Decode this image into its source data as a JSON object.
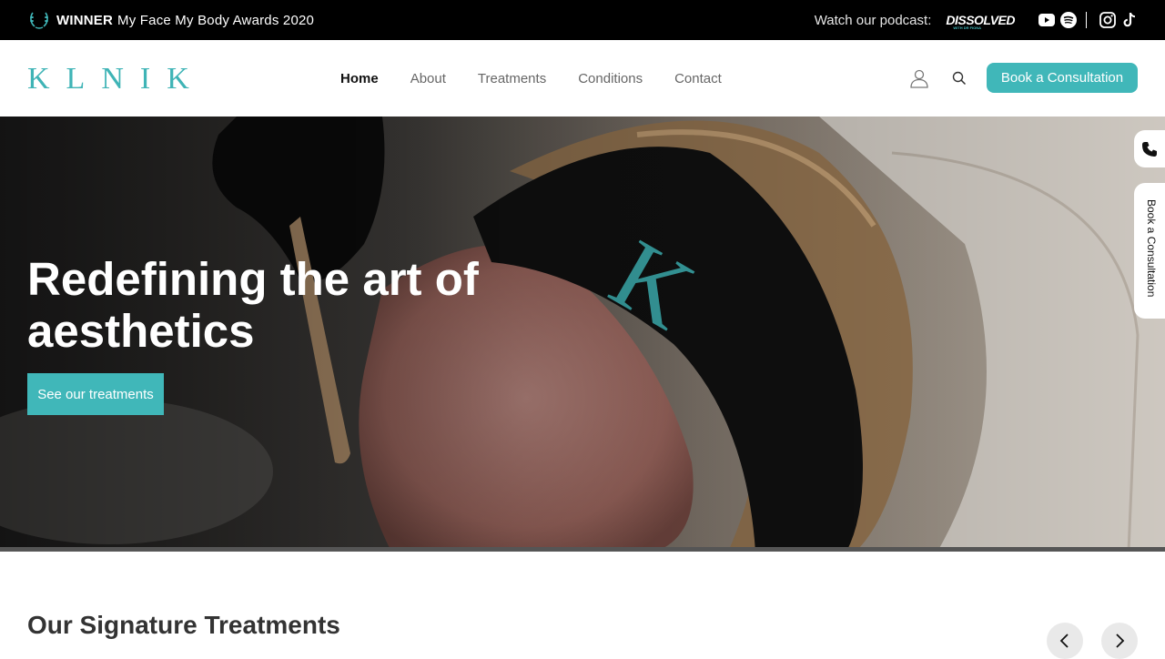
{
  "topbar": {
    "award_bold": "WINNER",
    "award_text": "My Face My Body Awards 2020",
    "podcast_label": "Watch our podcast:",
    "podcast_name": "DISSOLVED",
    "podcast_sub": "WITH DR FIONA"
  },
  "header": {
    "logo": "KLNIK",
    "nav": [
      "Home",
      "About",
      "Treatments",
      "Conditions",
      "Contact"
    ],
    "cta": "Book a Consultation"
  },
  "hero": {
    "title": "Redefining the art of aesthetics",
    "button": "See our treatments"
  },
  "side": {
    "book_label": "Book a Consultation"
  },
  "signature": {
    "title": "Our Signature Treatments"
  },
  "colors": {
    "accent": "#40b7b9",
    "topbar_bg": "#000000"
  },
  "icons": [
    "laurel-icon",
    "youtube-icon",
    "spotify-icon",
    "instagram-icon",
    "tiktok-icon",
    "user-icon",
    "search-icon",
    "phone-icon",
    "chevron-left-icon",
    "chevron-right-icon"
  ]
}
